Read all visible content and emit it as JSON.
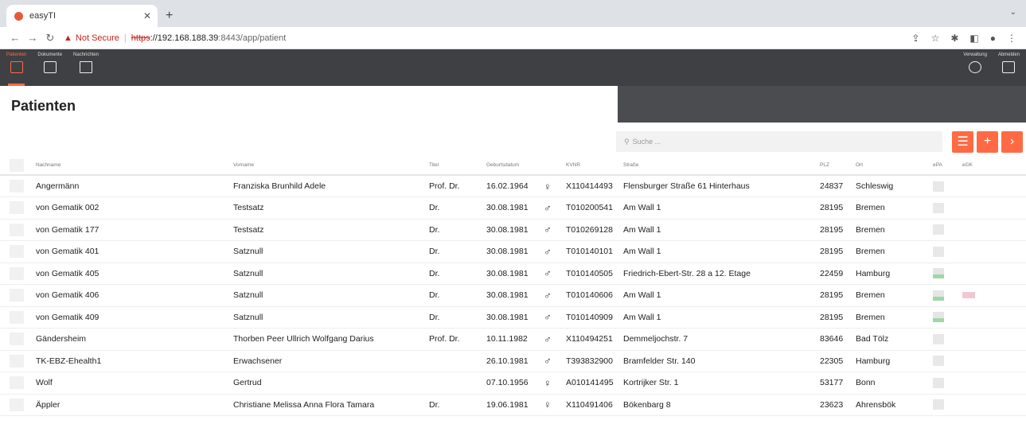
{
  "browser": {
    "tab_title": "easyTI",
    "not_secure": "Not Secure",
    "url_scheme": "https",
    "url_host": "://192.168.188.39",
    "url_path": ":8443/app/patient"
  },
  "nav": {
    "left": [
      {
        "label": "Patienten",
        "icon": "patient-icon"
      },
      {
        "label": "Dokumente",
        "icon": "document-icon"
      },
      {
        "label": "Nachrichten",
        "icon": "mail-icon"
      }
    ],
    "right": [
      {
        "label": "Verwaltung",
        "icon": "gear-icon"
      },
      {
        "label": "Abmelden",
        "icon": "logout-icon"
      }
    ]
  },
  "page": {
    "title": "Patienten"
  },
  "search": {
    "placeholder": "Suche ..."
  },
  "columns": [
    "Nachname",
    "Vorname",
    "Titel",
    "Geburtsdatum",
    "KVNR",
    "Straße",
    "PLZ",
    "Ort",
    "ePA",
    "eGK"
  ],
  "rows": [
    {
      "nachname": "Angermänn",
      "vorname": "Franziska Brunhild Adele",
      "titel": "Prof. Dr.",
      "geburtsdatum": "16.02.1964",
      "gender": "♀",
      "kvnr": "X110414493",
      "strasse": "Flensburger Straße 61 Hinterhaus",
      "plz": "24837",
      "ort": "Schleswig",
      "epa": "grey",
      "egk": false
    },
    {
      "nachname": "von Gematik 002",
      "vorname": "Testsatz",
      "titel": "Dr.",
      "geburtsdatum": "30.08.1981",
      "gender": "♂",
      "kvnr": "T010200541",
      "strasse": "Am Wall 1",
      "plz": "28195",
      "ort": "Bremen",
      "epa": "grey",
      "egk": false
    },
    {
      "nachname": "von Gematik 177",
      "vorname": "Testsatz",
      "titel": "Dr.",
      "geburtsdatum": "30.08.1981",
      "gender": "♂",
      "kvnr": "T010269128",
      "strasse": "Am Wall 1",
      "plz": "28195",
      "ort": "Bremen",
      "epa": "grey",
      "egk": false
    },
    {
      "nachname": "von Gematik 401",
      "vorname": "Satznull",
      "titel": "Dr.",
      "geburtsdatum": "30.08.1981",
      "gender": "♂",
      "kvnr": "T010140101",
      "strasse": "Am Wall 1",
      "plz": "28195",
      "ort": "Bremen",
      "epa": "grey",
      "egk": false
    },
    {
      "nachname": "von Gematik 405",
      "vorname": "Satznull",
      "titel": "Dr.",
      "geburtsdatum": "30.08.1981",
      "gender": "♂",
      "kvnr": "T010140505",
      "strasse": "Friedrich-Ebert-Str. 28 a 12. Etage",
      "plz": "22459",
      "ort": "Hamburg",
      "epa": "green",
      "egk": false
    },
    {
      "nachname": "von Gematik 406",
      "vorname": "Satznull",
      "titel": "Dr.",
      "geburtsdatum": "30.08.1981",
      "gender": "♂",
      "kvnr": "T010140606",
      "strasse": "Am Wall 1",
      "plz": "28195",
      "ort": "Bremen",
      "epa": "green",
      "egk": true
    },
    {
      "nachname": "von Gematik 409",
      "vorname": "Satznull",
      "titel": "Dr.",
      "geburtsdatum": "30.08.1981",
      "gender": "♂",
      "kvnr": "T010140909",
      "strasse": "Am Wall 1",
      "plz": "28195",
      "ort": "Bremen",
      "epa": "green",
      "egk": false
    },
    {
      "nachname": "Gändersheim",
      "vorname": "Thorben Peer Ullrich Wolfgang Darius",
      "titel": "Prof. Dr.",
      "geburtsdatum": "10.11.1982",
      "gender": "♂",
      "kvnr": "X110494251",
      "strasse": "Demmeljochstr. 7",
      "plz": "83646",
      "ort": "Bad Tölz",
      "epa": "grey",
      "egk": false
    },
    {
      "nachname": "TK-EBZ-Ehealth1",
      "vorname": "Erwachsener",
      "titel": "",
      "geburtsdatum": "26.10.1981",
      "gender": "♂",
      "kvnr": "T393832900",
      "strasse": "Bramfelder Str. 140",
      "plz": "22305",
      "ort": "Hamburg",
      "epa": "grey",
      "egk": false
    },
    {
      "nachname": "Wolf",
      "vorname": "Gertrud",
      "titel": "",
      "geburtsdatum": "07.10.1956",
      "gender": "♀",
      "kvnr": "A010141495",
      "strasse": "Kortrijker Str. 1",
      "plz": "53177",
      "ort": "Bonn",
      "epa": "grey",
      "egk": false
    },
    {
      "nachname": "Äppler",
      "vorname": "Christiane Melissa Anna Flora Tamara",
      "titel": "Dr.",
      "geburtsdatum": "19.06.1981",
      "gender": "♀",
      "kvnr": "X110491406",
      "strasse": "Bökenbarg 8",
      "plz": "23623",
      "ort": "Ahrensbök",
      "epa": "grey",
      "egk": false
    }
  ]
}
